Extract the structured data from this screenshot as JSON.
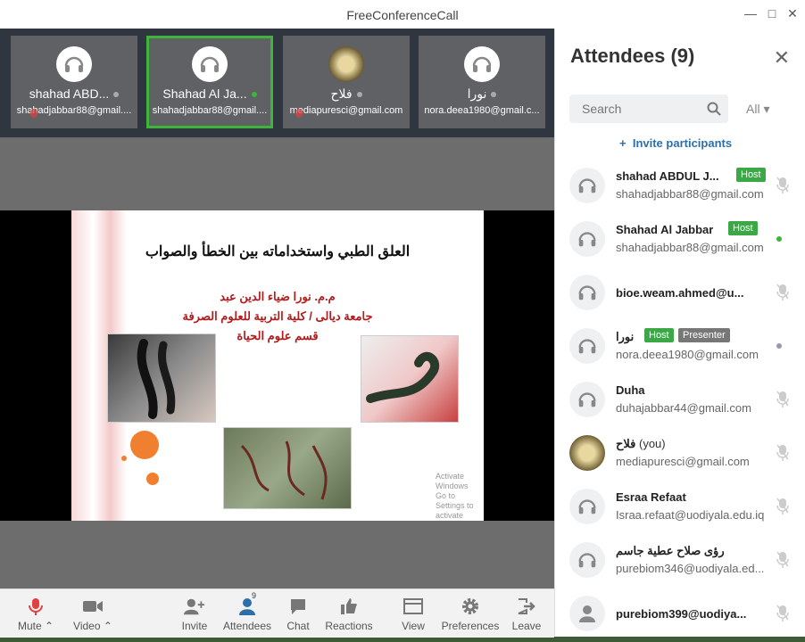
{
  "window": {
    "title": "FreeConferenceCall"
  },
  "tiles": [
    {
      "name": "shahad ABD...",
      "email": "shahadjabbar88@gmail....",
      "status": "grey"
    },
    {
      "name": "Shahad Al Ja...",
      "email": "shahadjabbar88@gmail....",
      "status": "green"
    },
    {
      "name": "فلاح",
      "email": "mediapuresci@gmail.com",
      "status": "grey"
    },
    {
      "name": "نورا",
      "email": "nora.deea1980@gmail.c...",
      "status": "grey"
    }
  ],
  "slide": {
    "title": "العلق الطبي واستخداماته بين الخطأ والصواب",
    "line1": "م.م. نورا ضياء الدين عبد",
    "line2": "جامعة ديالى / كلية التربية للعلوم الصرفة",
    "line3": "قسم علوم الحياة",
    "watermark1": "Activate Windows",
    "watermark2": "Go to Settings to activate Windows."
  },
  "toolbar": {
    "mute": "Mute",
    "video": "Video",
    "invite": "Invite",
    "attendees": "Attendees",
    "attendees_count": "9",
    "chat": "Chat",
    "reactions": "Reactions",
    "view": "View",
    "preferences": "Preferences",
    "leave": "Leave"
  },
  "panel": {
    "title": "Attendees (9)",
    "search_placeholder": "Search",
    "filter": "All",
    "invite_label": "Invite participants",
    "host_tag": "Host",
    "presenter_tag": "Presenter",
    "you_label": "(you)"
  },
  "attendees": [
    {
      "name": "shahad ABDUL J...",
      "email": "shahadjabbar88@gmail.com",
      "host": true,
      "presenter": false
    },
    {
      "name": "Shahad Al Jabbar",
      "email": "shahadjabbar88@gmail.com",
      "host": true,
      "presenter": false
    },
    {
      "name": "bioe.weam.ahmed@u...",
      "email": "",
      "host": false,
      "presenter": false
    },
    {
      "name": "نورا",
      "email": "nora.deea1980@gmail.com",
      "host": true,
      "presenter": true
    },
    {
      "name": "Duha",
      "email": "duhajabbar44@gmail.com",
      "host": false,
      "presenter": false
    },
    {
      "name": "فلاح",
      "email": "mediapuresci@gmail.com",
      "host": false,
      "presenter": false,
      "you": true
    },
    {
      "name": "Esraa Refaat",
      "email": "Israa.refaat@uodiyala.edu.iq",
      "host": false,
      "presenter": false
    },
    {
      "name": "رؤى صلاح عطية جاسم",
      "email": "purebiom346@uodiyala.ed...",
      "host": false,
      "presenter": false
    },
    {
      "name": "purebiom399@uodiya...",
      "email": "",
      "host": false,
      "presenter": false
    }
  ],
  "colors": {
    "host": "#3aa844",
    "presenter": "#777777",
    "active": "#3fb43a",
    "link": "#2d6fa8"
  }
}
